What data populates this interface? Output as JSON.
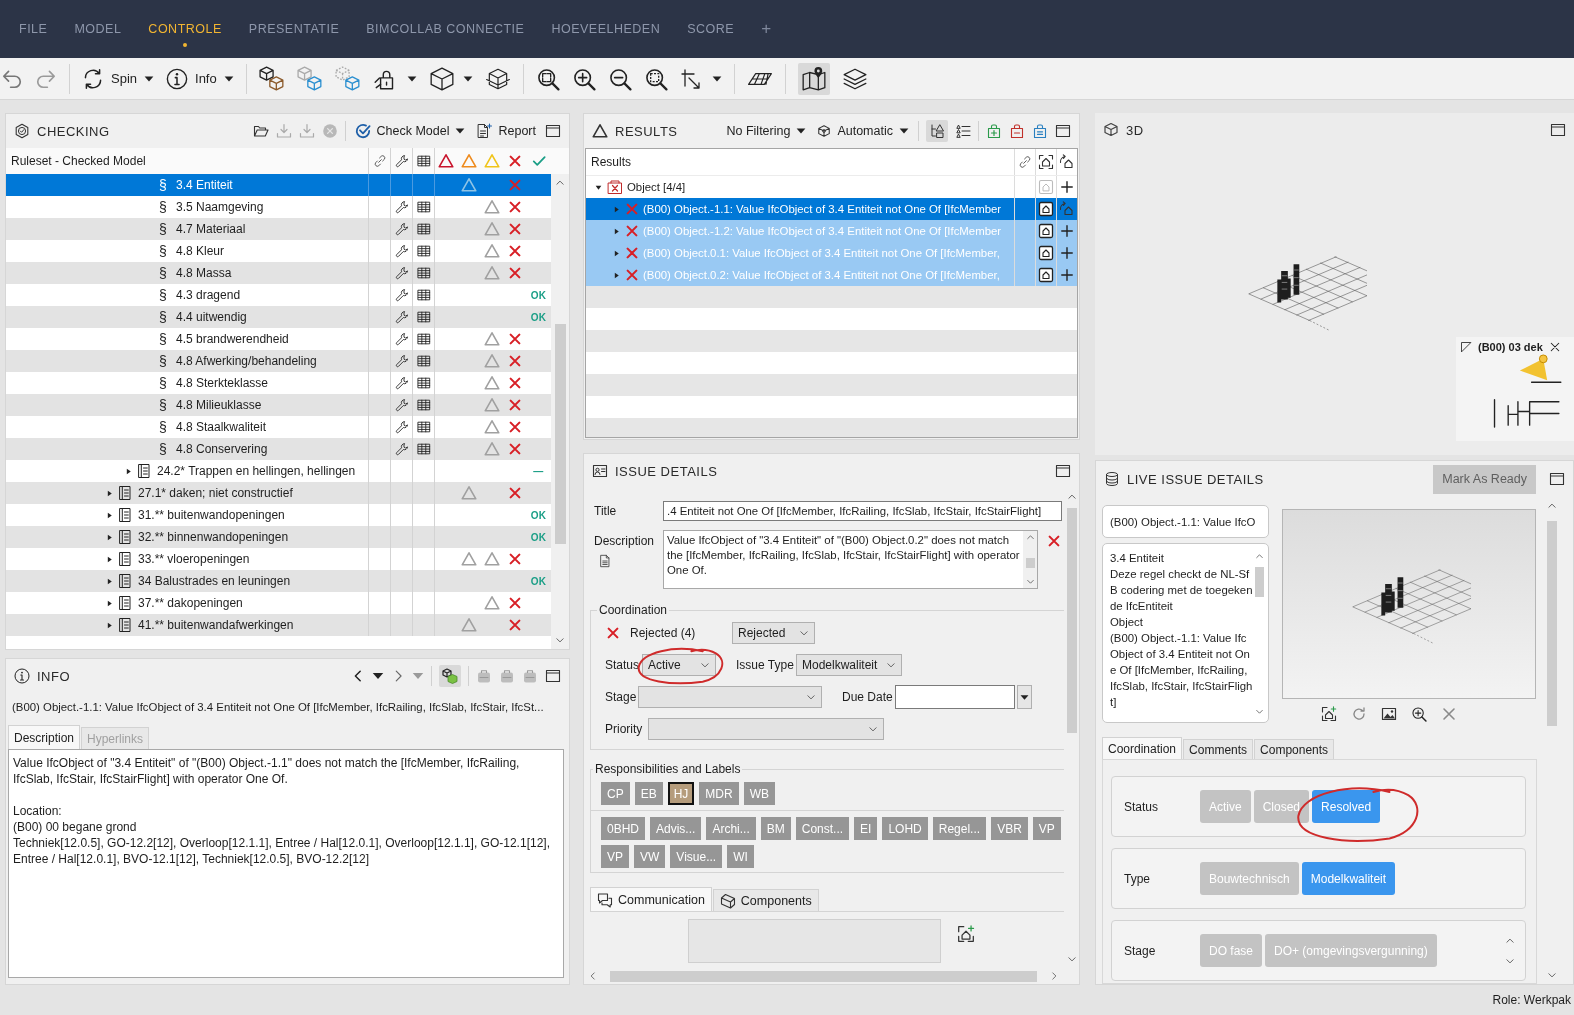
{
  "menu": {
    "tabs": [
      {
        "label": "FILE",
        "selected": false
      },
      {
        "label": "MODEL",
        "selected": false
      },
      {
        "label": "CONTROLE",
        "selected": true
      },
      {
        "label": "PRESENTATIE",
        "selected": false
      },
      {
        "label": "BIMCOLLAB CONNECTIE",
        "selected": false
      },
      {
        "label": "HOEVEELHEDEN",
        "selected": false
      },
      {
        "label": "SCORE",
        "selected": false
      }
    ],
    "add_tab": "+"
  },
  "toolbar": {
    "spin": "Spin",
    "info": "Info",
    "map_active": true
  },
  "checking": {
    "title": "CHECKING",
    "check_model": "Check Model",
    "report": "Report",
    "tree_header": "Ruleset - Checked Model",
    "rows": [
      {
        "children": [
          {
            "children": [
              {
                "kind": "rule",
                "symbol": "§",
                "label": "3.4 Entiteit",
                "selected": true,
                "tools": false,
                "warning": true,
                "info": false,
                "failed": true
              },
              {
                "kind": "rule",
                "symbol": "§",
                "label": "3.5 Naamgeving",
                "selected": false,
                "tools": true,
                "warning": false,
                "info": true,
                "failed": true
              },
              {
                "kind": "rule",
                "symbol": "§",
                "label": "4.7 Materiaal",
                "selected": false,
                "tools": true,
                "warning": false,
                "info": true,
                "failed": true
              },
              {
                "kind": "rule",
                "symbol": "§",
                "label": "4.8 Kleur",
                "selected": false,
                "tools": true,
                "warning": false,
                "info": true,
                "failed": true
              },
              {
                "kind": "rule",
                "symbol": "§",
                "label": "4.8 Massa",
                "selected": false,
                "tools": true,
                "warning": false,
                "info": true,
                "failed": true
              },
              {
                "kind": "rule",
                "symbol": "§",
                "label": "4.3 dragend",
                "selected": false,
                "tools": true,
                "warning": false,
                "info": false,
                "failed": false,
                "result": "OK"
              },
              {
                "kind": "rule",
                "symbol": "§",
                "label": "4.4 uitwendig",
                "selected": false,
                "tools": true,
                "warning": false,
                "info": false,
                "failed": false,
                "result": "OK"
              },
              {
                "kind": "rule",
                "symbol": "§",
                "label": "4.5 brandwerendheid",
                "selected": false,
                "tools": true,
                "warning": false,
                "info": true,
                "failed": true
              },
              {
                "kind": "rule",
                "symbol": "§",
                "label": "4.8 Afwerking/behandeling",
                "selected": false,
                "tools": true,
                "warning": false,
                "info": true,
                "failed": true
              },
              {
                "kind": "rule",
                "symbol": "§",
                "label": "4.8 Sterkteklasse",
                "selected": false,
                "tools": true,
                "warning": false,
                "info": true,
                "failed": true
              },
              {
                "kind": "rule",
                "symbol": "§",
                "label": "4.8 Milieuklasse",
                "selected": false,
                "tools": true,
                "warning": false,
                "info": true,
                "failed": true
              },
              {
                "kind": "rule",
                "symbol": "§",
                "label": "4.8 Staalkwaliteit",
                "selected": false,
                "tools": true,
                "warning": false,
                "info": true,
                "failed": true
              },
              {
                "kind": "rule",
                "symbol": "§",
                "label": "4.8 Conservering",
                "selected": false,
                "tools": true,
                "warning": false,
                "info": true,
                "failed": true
              }
            ]
          },
          {
            "kind": "group",
            "label": "24.2* Trappen en hellingen, hellingen",
            "expanded": false,
            "selected": false,
            "tools": false,
            "warning": false,
            "info": false,
            "failed": false,
            "result": "—"
          }
        ]
      },
      {
        "kind": "group",
        "label": "27.1* daken; niet constructief",
        "expanded": false,
        "selected": false,
        "tools": false,
        "warning": true,
        "info": false,
        "failed": true
      },
      {
        "kind": "group",
        "label": "31.** buitenwandopeningen",
        "expanded": false,
        "selected": false,
        "tools": false,
        "warning": false,
        "info": false,
        "failed": false,
        "result": "OK"
      },
      {
        "kind": "group",
        "label": "32.** binnenwandopeningen",
        "expanded": false,
        "selected": false,
        "tools": false,
        "warning": false,
        "info": false,
        "failed": false,
        "result": "OK"
      },
      {
        "kind": "group",
        "label": "33.** vloeropeningen",
        "expanded": false,
        "selected": false,
        "tools": false,
        "warning": true,
        "info": true,
        "failed": true
      },
      {
        "kind": "group",
        "label": "34 Balustrades en leuningen",
        "expanded": false,
        "selected": false,
        "tools": false,
        "warning": false,
        "info": false,
        "failed": false,
        "result": "OK"
      },
      {
        "kind": "group",
        "label": "37.** dakopeningen",
        "expanded": false,
        "selected": false,
        "tools": false,
        "warning": false,
        "info": true,
        "failed": true
      },
      {
        "kind": "group",
        "label": "41.** buitenwandafwerkingen",
        "expanded": false,
        "selected": false,
        "tools": false,
        "warning": true,
        "info": false,
        "failed": true
      }
    ]
  },
  "results": {
    "title": "RESULTS",
    "filter": "No Filtering",
    "mode": "Automatic",
    "tree_view_active": true,
    "tree_header": "Results",
    "groups": [
      {
        "kind": "group",
        "label": "Object [4/4]",
        "expanded": true,
        "selected": false,
        "focused": false,
        "children": [
          {
            "kind": "issue",
            "label": "(B00) Object.-1.1: Value IfcObject of 3.4 Entiteit not One Of [IfcMember",
            "expanded": false,
            "selected": true,
            "focused": true
          },
          {
            "kind": "issue",
            "label": "(B00) Object.-1.2: Value IfcObject of 3.4 Entiteit not One Of [IfcMember",
            "expanded": false,
            "selected": true,
            "focused": false
          },
          {
            "kind": "issue",
            "label": "(B00) Object.0.1: Value IfcObject of 3.4 Entiteit not One Of [IfcMember,",
            "expanded": false,
            "selected": true,
            "focused": false
          },
          {
            "kind": "issue",
            "label": "(B00) Object.0.2: Value IfcObject of 3.4 Entiteit not One Of [IfcMember,",
            "expanded": false,
            "selected": true,
            "focused": false
          }
        ]
      }
    ]
  },
  "viewer": {
    "title": "3D",
    "minimap_label": "(B00) 03 dek"
  },
  "info": {
    "title": "INFO",
    "objects_toggle_active": true,
    "summary": "(B00) Object.-1.1: Value IfcObject of 3.4 Entiteit not One Of [IfcMember, IfcRailing, IfcSlab, IfcStair, IfcSt...",
    "tabs": [
      {
        "label": "Description",
        "selected": true,
        "disabled": false
      },
      {
        "label": "Hyperlinks",
        "selected": false,
        "disabled": true
      }
    ],
    "description": "Value IfcObject of \"3.4 Entiteit\" of \"(B00) Object.-1.1\" does not match the [IfcMember, IfcRailing, IfcSlab, IfcStair, IfcStairFlight] with operator One Of.\n\nLocation:\n(B00) 00 begane grond\nTechniek[12.0.5], GO-12.2[12], Overloop[12.1.1], Entree / Hal[12.0.1], Overloop[12.1.1], GO-12.1[12], Entree / Hal[12.0.1], BVO-12.1[12], Techniek[12.0.5], BVO-12.2[12]"
  },
  "issue": {
    "title": "ISSUE DETAILS",
    "title_label": "Title",
    "title_value": ".4 Entiteit not One Of [IfcMember, IfcRailing, IfcSlab, IfcStair, IfcStairFlight]",
    "description_label": "Description",
    "description_value": "Value IfcObject of \"3.4 Entiteit\" of \"(B00) Object.0.2\" does not match the [IfcMember, IfcRailing, IfcSlab, IfcStair, IfcStairFlight] with operator One Of.",
    "coordination": {
      "legend": "Coordination",
      "result": "Rejected (4)",
      "result_choice": "Rejected",
      "status": {
        "label": "Status",
        "value": "Active"
      },
      "issue_type": {
        "label": "Issue Type",
        "value": "Modelkwaliteit"
      },
      "stage": {
        "label": "Stage"
      },
      "due_date": {
        "label": "Due Date"
      },
      "priority": {
        "label": "Priority"
      }
    },
    "labels": {
      "legend": "Responsibilities and Labels",
      "responsibilities": [
        {
          "label": "CP",
          "selected": false
        },
        {
          "label": "EB",
          "selected": false
        },
        {
          "label": "HJ",
          "selected": true
        },
        {
          "label": "MDR",
          "selected": false
        },
        {
          "label": "WB",
          "selected": false
        }
      ],
      "tags": [
        {
          "label": "0BHD",
          "selected": false
        },
        {
          "label": "Advis...",
          "selected": false
        },
        {
          "label": "Archi...",
          "selected": false
        },
        {
          "label": "BM",
          "selected": false
        },
        {
          "label": "Const...",
          "selected": false
        },
        {
          "label": "EI",
          "selected": false
        },
        {
          "label": "LOHD",
          "selected": false
        },
        {
          "label": "Regel...",
          "selected": false
        },
        {
          "label": "VBR",
          "selected": false
        },
        {
          "label": "VP",
          "selected": false
        },
        {
          "label": "VP",
          "selected": false
        },
        {
          "label": "VW",
          "selected": false
        },
        {
          "label": "Visue...",
          "selected": false
        },
        {
          "label": "WI",
          "selected": false
        }
      ]
    },
    "tabs": [
      {
        "label": "Communication",
        "selected": true
      },
      {
        "label": "Components",
        "selected": false
      }
    ]
  },
  "live": {
    "title": "LIVE ISSUE DETAILS",
    "mark_ready": {
      "label": "Mark As Ready",
      "disabled": true
    },
    "issue_title": "(B00) Object.-1.1: Value IfcO",
    "notes": "3.4 Entiteit\nDeze regel checkt de NL-SfB codering met de toegekende IfcEntiteit\nObject\n(B00) Object.-1.1: Value IfcObject of 3.4 Entiteit not One Of [IfcMember, IfcRailing, IfcSlab, IfcStair, IfcStairFlight]",
    "tabs": [
      {
        "label": "Coordination",
        "selected": true
      },
      {
        "label": "Comments",
        "selected": false
      },
      {
        "label": "Components",
        "selected": false
      }
    ],
    "groups": [
      {
        "label": "Status",
        "scrollable": false,
        "options": [
          {
            "label": "Active",
            "selected": false
          },
          {
            "label": "Closed",
            "selected": false
          },
          {
            "label": "Resolved",
            "selected": true
          }
        ]
      },
      {
        "label": "Type",
        "scrollable": false,
        "options": [
          {
            "label": "Bouwtechnisch",
            "selected": false
          },
          {
            "label": "Modelkwaliteit",
            "selected": true
          }
        ]
      },
      {
        "label": "Stage",
        "scrollable": true,
        "options": [
          {
            "label": "DO fase",
            "selected": false
          },
          {
            "label": "DO+ (omgevingsvergunning)",
            "selected": false
          }
        ]
      }
    ]
  },
  "status_bar": {
    "role": "Role: Werkpak"
  }
}
